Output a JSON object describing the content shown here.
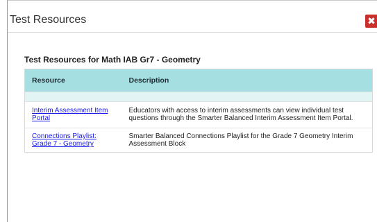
{
  "modal": {
    "title": "Test Resources",
    "close_label": "✖"
  },
  "section": {
    "title": "Test Resources for Math IAB Gr7 - Geometry"
  },
  "table": {
    "headers": [
      "Resource",
      "Description"
    ],
    "rows": [
      {
        "resource": "Interim Assessment Item Portal",
        "description": "Educators with access to interim assessments can view individual test questions through the Smarter Balanced Interim Assessment Item Portal."
      },
      {
        "resource": "Connections Playlist: Grade 7 - Geometry",
        "description": "Smarter Balanced Connections Playlist for the Grade 7 Geometry Interim Assessment Block"
      }
    ]
  },
  "colors": {
    "close_button": "#c9302c",
    "table_header": "#a6dfe2",
    "link": "#1a1aee"
  }
}
